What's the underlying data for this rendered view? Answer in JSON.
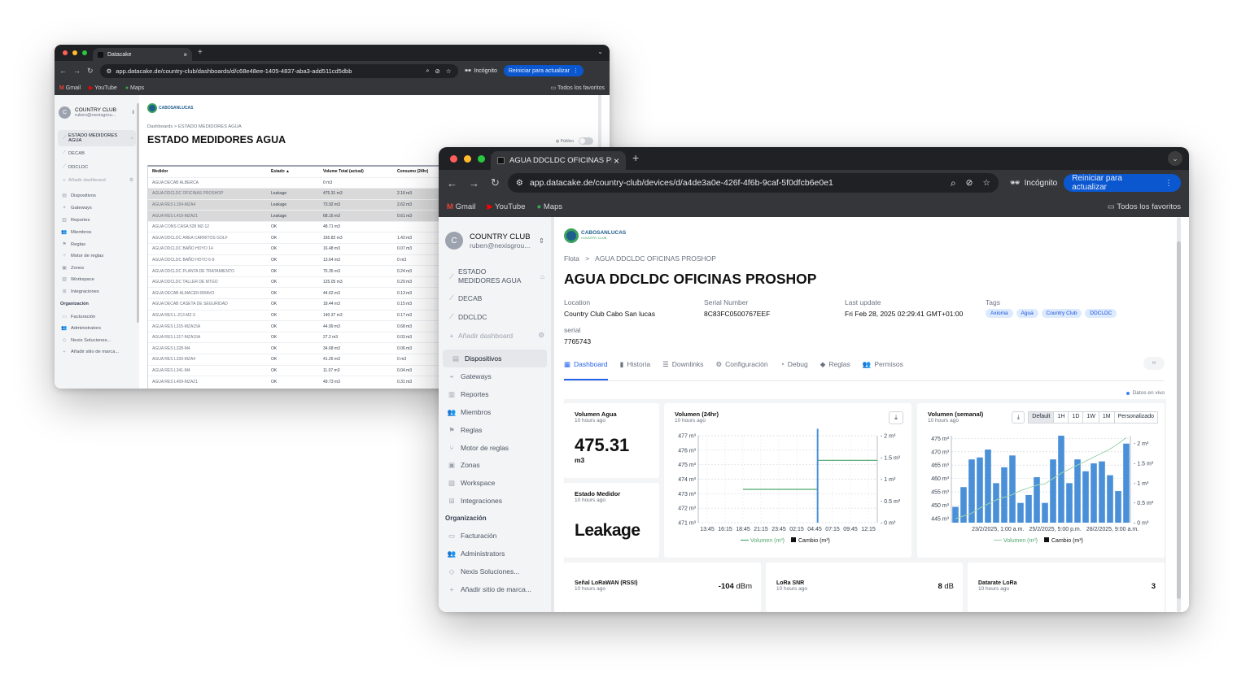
{
  "back": {
    "tab_title": "Datacake",
    "url": "app.datacake.de/country-club/dashboards/d/c68e48ee-1405-4837-aba3-add511cd5dbb",
    "incognito": "Incógnito",
    "reinit": "Reiniciar para actualizar",
    "bookmarks": [
      "Gmail",
      "YouTube",
      "Maps"
    ],
    "all_favs": "Todos los favoritos",
    "workspace_name": "COUNTRY CLUB",
    "workspace_email": "ruben@nexisgrou...",
    "avatar": "C",
    "nav_dash": [
      {
        "label": "ESTADO MEDIDORES AGUA",
        "icon": "chart-icon"
      },
      {
        "label": "DECAB",
        "icon": "chart-icon"
      },
      {
        "label": "DDCLDC",
        "icon": "chart-icon"
      }
    ],
    "add_dashboard": "Añadir dashboard",
    "nav_main": [
      "Dispositivos",
      "Gateways",
      "Reportes",
      "Miembros",
      "Reglas",
      "Motor de reglas",
      "Zones",
      "Workspace",
      "Integraciones"
    ],
    "org_header": "Organización",
    "nav_org": [
      "Facturación",
      "Administrators",
      "Nexis Soluciones...",
      "Añadir sitio de marca..."
    ],
    "breadcrumb": [
      "Dashboards",
      "ESTADO MEDIDORES AGUA"
    ],
    "title": "ESTADO MEDIDORES AGUA",
    "public_label": "Público",
    "table_headers": [
      "Medidor",
      "Estado ▲",
      "Volume Total (actual)",
      "Consumo (24hr)"
    ],
    "rows": [
      [
        "AGUA DECAB ALBERCA",
        "",
        "0 m3",
        ""
      ],
      [
        "AGUA DDCLDC OFICINAS PROSHOP",
        "Leakage",
        "475.31 m3",
        "2.16 m3"
      ],
      [
        "AGUA RES L154-MZA4",
        "Leakage",
        "73.92 m3",
        "2.62 m3"
      ],
      [
        "AGUA RES L419-MZA21",
        "Leakage",
        "68.16 m3",
        "0.61 m3"
      ],
      [
        "AGUA CONS CASA 528 MZ-12",
        "OK",
        "48.71 m3",
        ""
      ],
      [
        "AGUA DDCLDC AREA CARRITOS GOLF",
        "OK",
        "165.82 m3",
        "1.43 m3"
      ],
      [
        "AGUA DDCLDC BAÑO HOYO 14",
        "OK",
        "16.48 m3",
        "0.07 m3"
      ],
      [
        "AGUA DDCLDC BAÑO HOYO 6-9",
        "OK",
        "13.64 m3",
        "0 m3"
      ],
      [
        "AGUA DDCLDC PLANTA DE TRATAMIENTO",
        "OK",
        "75.35 m3",
        "0.24 m3"
      ],
      [
        "AGUA DDCLDC TALLER DE MTGO",
        "OK",
        "125.05 m3",
        "0.29 m3"
      ],
      [
        "AGUA DECAB ALMACEN BRAVO",
        "OK",
        "44.62 m3",
        "0.13 m3"
      ],
      [
        "AGUA DECAB CASETA DE SEGURIDAD",
        "OK",
        "18.44 m3",
        "0.15 m3"
      ],
      [
        "AGUA RES L-213 MZ-3",
        "OK",
        "140.37 m3",
        "0.17 m3"
      ],
      [
        "AGUA RES L315-MZA15A",
        "OK",
        "44.99 m3",
        "0.68 m3"
      ],
      [
        "AGUA RES L317-MZA15A",
        "OK",
        "27.2 m3",
        "0.03 m3"
      ],
      [
        "AGUA RES L328-M4",
        "OK",
        "34.68 m3",
        "0.06 m3"
      ],
      [
        "AGUA RES L339-MZA4",
        "OK",
        "41.26 m3",
        "0 m3"
      ],
      [
        "AGUA RES L341-M4",
        "OK",
        "11.07 m3",
        "0.04 m3"
      ],
      [
        "AGUA RES L409-MZA21",
        "OK",
        "49.73 m3",
        "0.31 m3"
      ]
    ],
    "logo_text": "CABOSANLUCAS"
  },
  "front": {
    "tab_title": "AGUA DDCLDC OFICINAS PR",
    "url": "app.datacake.de/country-club/devices/d/a4de3a0e-426f-4f6b-9caf-5f0dfcb6e0e1",
    "incognito": "Incógnito",
    "reinit": "Reiniciar para actualizar",
    "bookmarks": [
      "Gmail",
      "YouTube",
      "Maps"
    ],
    "all_favs": "Todos los favoritos",
    "workspace_name": "COUNTRY CLUB",
    "workspace_email": "ruben@nexisgrou...",
    "avatar": "C",
    "nav_dash": [
      {
        "label": "ESTADO MEDIDORES AGUA",
        "icon": "chart-icon"
      },
      {
        "label": "DECAB",
        "icon": "chart-icon"
      },
      {
        "label": "DDCLDC",
        "icon": "chart-icon"
      }
    ],
    "add_dashboard": "Añadir dashboard",
    "nav_main": [
      "Dispositivos",
      "Gateways",
      "Reportes",
      "Miembros",
      "Reglas",
      "Motor de reglas",
      "Zonas",
      "Workspace",
      "Integraciones"
    ],
    "org_header": "Organización",
    "nav_org": [
      "Facturación",
      "Administrators",
      "Nexis Soluciones...",
      "Añadir sitio de marca..."
    ],
    "logo_text": "CABOSANLUCAS",
    "logo_sub": "COUNTRY CLUB",
    "breadcrumb": [
      "Flota",
      "AGUA DDCLDC OFICINAS PROSHOP"
    ],
    "title": "AGUA DDCLDC OFICINAS PROSHOP",
    "meta": {
      "location_label": "Location",
      "location": "Country Club Cabo San lucas",
      "serial_label": "Serial Number",
      "serial": "8C83FC0500767EEF",
      "update_label": "Last update",
      "update": "Fri Feb 28, 2025 02:29:41 GMT+01:00",
      "tags_label": "Tags",
      "tags": [
        "Axioma",
        "Agua",
        "Country Club",
        "DDCLDC"
      ],
      "serial2_label": "serial",
      "serial2": "7765743"
    },
    "tabs": [
      "Dashboard",
      "Historia",
      "Downlinks",
      "Configuración",
      "Debug",
      "Reglas",
      "Permisos"
    ],
    "live": "Datos en vivo",
    "vol_card": {
      "title": "Volumen Agua",
      "ago": "10 hours ago",
      "value": "475.31",
      "unit": "m3"
    },
    "state_card": {
      "title": "Estado Medidor",
      "ago": "10 hours ago",
      "value": "Leakage"
    },
    "chart24": {
      "title": "Volumen (24hr)",
      "ago": "10 hours ago"
    },
    "chartweek": {
      "title": "Volumen (semanal)",
      "ago": "10 hours ago",
      "ranges": [
        "Default",
        "1H",
        "1D",
        "1W",
        "1M",
        "Personalizado"
      ]
    },
    "rssi": {
      "title": "Señal LoRaWAN (RSSI)",
      "ago": "10 hours ago",
      "value": "-104",
      "unit": "dBm"
    },
    "snr": {
      "title": "LoRa SNR",
      "ago": "10 hours ago",
      "value": "8",
      "unit": "dB"
    },
    "dr": {
      "title": "Datarate LoRa",
      "ago": "10 hours ago",
      "value": "3"
    }
  },
  "chart_data": [
    {
      "type": "line",
      "title": "Volumen (24hr)",
      "x": [
        "13:45",
        "16:15",
        "18:45",
        "21:15",
        "23:45",
        "02:15",
        "04:45",
        "07:15",
        "09:45",
        "12:15"
      ],
      "series": [
        {
          "name": "Volumen (m³)",
          "axis": "left",
          "values": [
            473.3,
            473.3,
            473.3,
            473.3,
            473.3,
            475.3,
            475.3,
            475.3,
            475.3,
            475.3
          ]
        },
        {
          "name": "Cambio (m³)",
          "axis": "right",
          "values": [
            0,
            0,
            0,
            0,
            0,
            2.16,
            0,
            0,
            0,
            0
          ]
        }
      ],
      "yleft": {
        "ticks": [
          "471 m³",
          "472 m³",
          "473 m³",
          "474 m³",
          "475 m³",
          "476 m³",
          "477 m³"
        ],
        "ylim": [
          471,
          477
        ]
      },
      "yright": {
        "ticks": [
          "0 m³",
          "0.5 m³",
          "1 m³",
          "1.5 m³",
          "2 m³"
        ],
        "ylim": [
          0,
          2
        ]
      },
      "colors": {
        "line": "#4ca76b",
        "bar": "#4a90d9"
      }
    },
    {
      "type": "bar",
      "title": "Volumen (semanal)",
      "x_ticks": [
        "23/2/2025, 1:00 a.m.",
        "25/2/2025, 5:00 p.m.",
        "28/2/2025, 9:00 a.m."
      ],
      "series": [
        {
          "name": "Cambio (m³)",
          "axis": "right",
          "values": [
            0.4,
            0.9,
            1.6,
            1.65,
            1.85,
            1.0,
            1.4,
            1.7,
            0.5,
            0.7,
            1.15,
            0.5,
            1.6,
            2.2,
            1.0,
            1.6,
            1.3,
            1.5,
            1.55,
            1.2,
            0.8,
            2.0
          ]
        },
        {
          "name": "Volumen (m³)",
          "axis": "left",
          "values": [
            445,
            446,
            447,
            449,
            450.5,
            452,
            453,
            454,
            455.5,
            456.5,
            457.5,
            458,
            460,
            462,
            463.5,
            465,
            466.5,
            468,
            469.5,
            471,
            473,
            475.3
          ]
        }
      ],
      "yleft": {
        "ticks": [
          "445 m³",
          "450 m³",
          "455 m³",
          "460 m³",
          "465 m³",
          "470 m³",
          "475 m³"
        ],
        "ylim": [
          443.5,
          476
        ]
      },
      "yright": {
        "ticks": [
          "0 m³",
          "0.5 m³",
          "1 m³",
          "1.5 m³",
          "2 m³"
        ],
        "ylim": [
          0,
          2.2
        ]
      },
      "colors": {
        "line": "#9fd3b0",
        "bar": "#4a90d9"
      }
    }
  ]
}
